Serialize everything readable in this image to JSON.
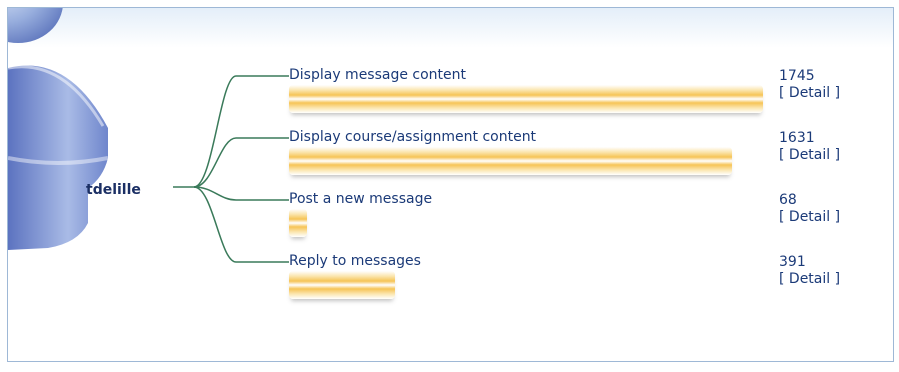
{
  "user": {
    "name": "tdelille"
  },
  "detail_label": "[ Detail ]",
  "colors": {
    "bar": "#f6c456",
    "text": "#1b3a78",
    "connector": "#3a7a5a",
    "border": "#9eb8d6"
  },
  "chart_data": {
    "type": "bar",
    "orientation": "horizontal",
    "categories": [
      "Display message content",
      "Display course/assignment content",
      "Post a new message",
      "Reply to messages"
    ],
    "values": [
      1745,
      1631,
      68,
      391
    ],
    "xlim": [
      0,
      1745
    ],
    "grid": false,
    "legend": "none"
  }
}
